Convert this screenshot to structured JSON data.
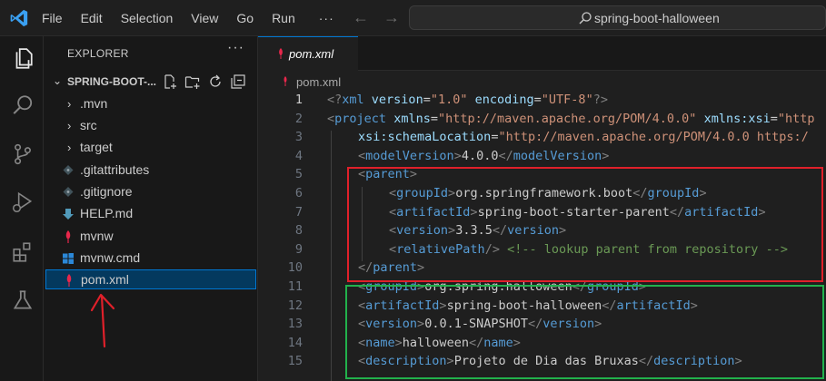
{
  "menu": [
    "File",
    "Edit",
    "Selection",
    "View",
    "Go",
    "Run"
  ],
  "menu_more": "···",
  "search": {
    "text": "spring-boot-halloween"
  },
  "explorer": {
    "title": "EXPLORER",
    "more": "···",
    "folder": "SPRING-BOOT-...",
    "items": [
      {
        "label": ".mvn",
        "kind": "folder"
      },
      {
        "label": "src",
        "kind": "folder"
      },
      {
        "label": "target",
        "kind": "folder"
      },
      {
        "label": ".gitattributes",
        "kind": "git"
      },
      {
        "label": ".gitignore",
        "kind": "git"
      },
      {
        "label": "HELP.md",
        "kind": "markdown"
      },
      {
        "label": "mvnw",
        "kind": "maven"
      },
      {
        "label": "mvnw.cmd",
        "kind": "windows"
      },
      {
        "label": "pom.xml",
        "kind": "maven",
        "selected": true
      }
    ]
  },
  "editor": {
    "tab_label": "pom.xml",
    "breadcrumb": "pom.xml"
  },
  "code_lines": [
    {
      "n": "1",
      "indent": 0,
      "tokens": [
        [
          "#808080",
          "<?"
        ],
        [
          "#569cd6",
          "xml"
        ],
        [
          "#cccccc",
          " "
        ],
        [
          "#9cdcfe",
          "version"
        ],
        [
          "#cccccc",
          "="
        ],
        [
          "#ce9178",
          "\"1.0\""
        ],
        [
          "#cccccc",
          " "
        ],
        [
          "#9cdcfe",
          "encoding"
        ],
        [
          "#cccccc",
          "="
        ],
        [
          "#ce9178",
          "\"UTF-8\""
        ],
        [
          "#808080",
          "?>"
        ]
      ]
    },
    {
      "n": "2",
      "indent": 0,
      "tokens": [
        [
          "#808080",
          "<"
        ],
        [
          "#569cd6",
          "project"
        ],
        [
          "#cccccc",
          " "
        ],
        [
          "#9cdcfe",
          "xmlns"
        ],
        [
          "#cccccc",
          "="
        ],
        [
          "#ce9178",
          "\"http://maven.apache.org/POM/4.0.0\""
        ],
        [
          "#cccccc",
          " "
        ],
        [
          "#9cdcfe",
          "xmlns:xsi"
        ],
        [
          "#cccccc",
          "="
        ],
        [
          "#ce9178",
          "\"http"
        ]
      ]
    },
    {
      "n": "3",
      "indent": 1,
      "tokens": [
        [
          "#9cdcfe",
          "xsi:schemaLocation"
        ],
        [
          "#cccccc",
          "="
        ],
        [
          "#ce9178",
          "\"http://maven.apache.org/POM/4.0.0 https:/"
        ]
      ]
    },
    {
      "n": "4",
      "indent": 1,
      "tokens": [
        [
          "#808080",
          "<"
        ],
        [
          "#569cd6",
          "modelVersion"
        ],
        [
          "#808080",
          ">"
        ],
        [
          "#cccccc",
          "4.0.0"
        ],
        [
          "#808080",
          "</"
        ],
        [
          "#569cd6",
          "modelVersion"
        ],
        [
          "#808080",
          ">"
        ]
      ]
    },
    {
      "n": "5",
      "indent": 1,
      "tokens": [
        [
          "#808080",
          "<"
        ],
        [
          "#569cd6",
          "parent"
        ],
        [
          "#808080",
          ">"
        ]
      ]
    },
    {
      "n": "6",
      "indent": 2,
      "tokens": [
        [
          "#808080",
          "<"
        ],
        [
          "#569cd6",
          "groupId"
        ],
        [
          "#808080",
          ">"
        ],
        [
          "#cccccc",
          "org.springframework.boot"
        ],
        [
          "#808080",
          "</"
        ],
        [
          "#569cd6",
          "groupId"
        ],
        [
          "#808080",
          ">"
        ]
      ]
    },
    {
      "n": "7",
      "indent": 2,
      "tokens": [
        [
          "#808080",
          "<"
        ],
        [
          "#569cd6",
          "artifactId"
        ],
        [
          "#808080",
          ">"
        ],
        [
          "#cccccc",
          "spring-boot-starter-parent"
        ],
        [
          "#808080",
          "</"
        ],
        [
          "#569cd6",
          "artifactId"
        ],
        [
          "#808080",
          ">"
        ]
      ]
    },
    {
      "n": "8",
      "indent": 2,
      "tokens": [
        [
          "#808080",
          "<"
        ],
        [
          "#569cd6",
          "version"
        ],
        [
          "#808080",
          ">"
        ],
        [
          "#cccccc",
          "3.3.5"
        ],
        [
          "#808080",
          "</"
        ],
        [
          "#569cd6",
          "version"
        ],
        [
          "#808080",
          ">"
        ]
      ]
    },
    {
      "n": "9",
      "indent": 2,
      "tokens": [
        [
          "#808080",
          "<"
        ],
        [
          "#569cd6",
          "relativePath"
        ],
        [
          "#808080",
          "/>"
        ],
        [
          "#cccccc",
          " "
        ],
        [
          "#6a9955",
          "<!-- lookup parent from repository -->"
        ]
      ]
    },
    {
      "n": "10",
      "indent": 1,
      "tokens": [
        [
          "#808080",
          "</"
        ],
        [
          "#569cd6",
          "parent"
        ],
        [
          "#808080",
          ">"
        ]
      ]
    },
    {
      "n": "11",
      "indent": 1,
      "tokens": [
        [
          "#808080",
          "<"
        ],
        [
          "#569cd6",
          "groupId"
        ],
        [
          "#808080",
          ">"
        ],
        [
          "#cccccc",
          "org.spring.halloween"
        ],
        [
          "#808080",
          "</"
        ],
        [
          "#569cd6",
          "groupId"
        ],
        [
          "#808080",
          ">"
        ]
      ]
    },
    {
      "n": "12",
      "indent": 1,
      "tokens": [
        [
          "#808080",
          "<"
        ],
        [
          "#569cd6",
          "artifactId"
        ],
        [
          "#808080",
          ">"
        ],
        [
          "#cccccc",
          "spring-boot-halloween"
        ],
        [
          "#808080",
          "</"
        ],
        [
          "#569cd6",
          "artifactId"
        ],
        [
          "#808080",
          ">"
        ]
      ]
    },
    {
      "n": "13",
      "indent": 1,
      "tokens": [
        [
          "#808080",
          "<"
        ],
        [
          "#569cd6",
          "version"
        ],
        [
          "#808080",
          ">"
        ],
        [
          "#cccccc",
          "0.0.1-SNAPSHOT"
        ],
        [
          "#808080",
          "</"
        ],
        [
          "#569cd6",
          "version"
        ],
        [
          "#808080",
          ">"
        ]
      ]
    },
    {
      "n": "14",
      "indent": 1,
      "tokens": [
        [
          "#808080",
          "<"
        ],
        [
          "#569cd6",
          "name"
        ],
        [
          "#808080",
          ">"
        ],
        [
          "#cccccc",
          "halloween"
        ],
        [
          "#808080",
          "</"
        ],
        [
          "#569cd6",
          "name"
        ],
        [
          "#808080",
          ">"
        ]
      ]
    },
    {
      "n": "15",
      "indent": 1,
      "tokens": [
        [
          "#808080",
          "<"
        ],
        [
          "#569cd6",
          "description"
        ],
        [
          "#808080",
          ">"
        ],
        [
          "#cccccc",
          "Projeto de Dia das Bruxas"
        ],
        [
          "#808080",
          "</"
        ],
        [
          "#569cd6",
          "description"
        ],
        [
          "#808080",
          ">"
        ]
      ]
    }
  ],
  "current_line": "1",
  "colors": {
    "accent": "#0078d4",
    "highlight_red": "#e0202a",
    "highlight_green": "#22b14c",
    "annotation_arrow": "#e0202a"
  },
  "icons": {
    "activity_bar": [
      "files-icon",
      "search-icon",
      "source-control-icon",
      "run-debug-icon",
      "extensions-icon",
      "testing-icon"
    ]
  }
}
